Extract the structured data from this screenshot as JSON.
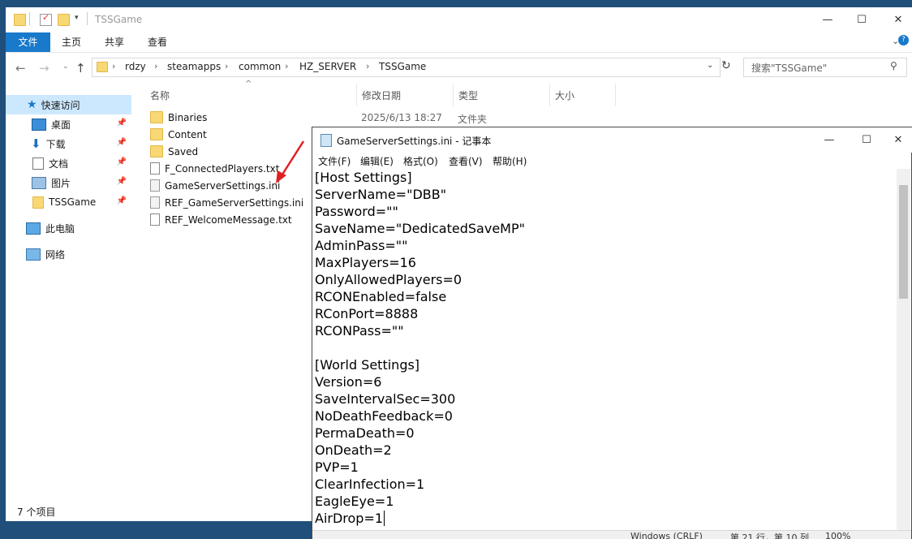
{
  "explorer": {
    "title": "TSSGame",
    "ribbon_tabs": [
      "文件",
      "主页",
      "共享",
      "查看"
    ],
    "breadcrumbs": [
      "rdzy",
      "steamapps",
      "common",
      "HZ_SERVER",
      "TSSGame"
    ],
    "search_placeholder": "搜索\"TSSGame\"",
    "nav": {
      "quick_access": "快速访问",
      "items": [
        "桌面",
        "下载",
        "文档",
        "图片",
        "TSSGame"
      ],
      "this_pc": "此电脑",
      "network": "网络"
    },
    "columns": [
      "名称",
      "修改日期",
      "类型",
      "大小"
    ],
    "files": [
      {
        "name": "Binaries",
        "date": "2025/6/13 18:27",
        "type": "文件夹",
        "kind": "folder"
      },
      {
        "name": "Content",
        "kind": "folder"
      },
      {
        "name": "Saved",
        "kind": "folder"
      },
      {
        "name": "F_ConnectedPlayers.txt",
        "kind": "txt"
      },
      {
        "name": "GameServerSettings.ini",
        "kind": "ini"
      },
      {
        "name": "REF_GameServerSettings.ini",
        "kind": "ini"
      },
      {
        "name": "REF_WelcomeMessage.txt",
        "kind": "txt"
      }
    ],
    "status": "7 个项目"
  },
  "notepad": {
    "title": "GameServerSettings.ini - 记事本",
    "menu": [
      "文件(F)",
      "编辑(E)",
      "格式(O)",
      "查看(V)",
      "帮助(H)"
    ],
    "lines": [
      "[Host Settings]",
      "ServerName=\"DBB\"",
      "Password=\"\"",
      "SaveName=\"DedicatedSaveMP\"",
      "AdminPass=\"\"",
      "MaxPlayers=16",
      "OnlyAllowedPlayers=0",
      "RCONEnabled=false",
      "RConPort=8888",
      "RCONPass=\"\"",
      "",
      "[World Settings]",
      "Version=6",
      "SaveIntervalSec=300",
      "NoDeathFeedback=0",
      "PermaDeath=0",
      "OnDeath=2",
      "PVP=1",
      "ClearInfection=1",
      "EagleEye=1",
      "AirDrop=1"
    ],
    "status": [
      "Windows (CRLF)",
      "第 21 行，第 10 列",
      "100%"
    ]
  },
  "colors": {
    "accent": "#1979ca",
    "folder": "#f8d775",
    "arrow": "#e02020"
  }
}
